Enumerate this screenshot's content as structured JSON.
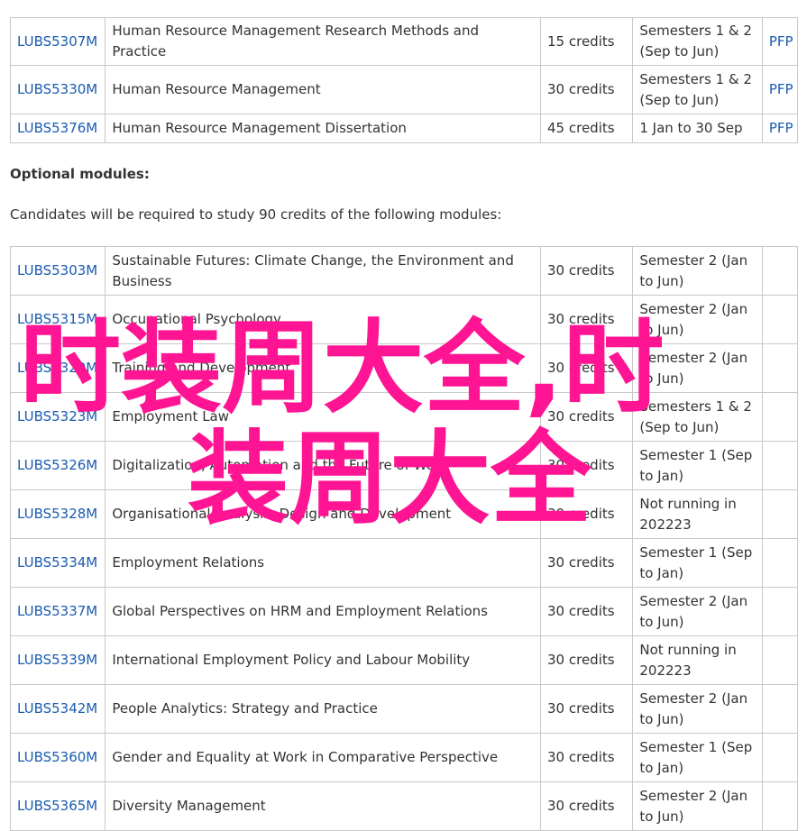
{
  "core_modules": [
    {
      "code": "LUBS5307M",
      "title": "Human Resource Management Research Methods and Practice",
      "credits": "15 credits",
      "semester": "Semesters 1 & 2 (Sep to Jun)",
      "pfp": "PFP"
    },
    {
      "code": "LUBS5330M",
      "title": "Human Resource Management",
      "credits": "30 credits",
      "semester": "Semesters 1 & 2 (Sep to Jun)",
      "pfp": "PFP"
    },
    {
      "code": "LUBS5376M",
      "title": "Human Resource Management Dissertation",
      "credits": "45 credits",
      "semester": "1 Jan to 30 Sep",
      "pfp": "PFP"
    }
  ],
  "optional_section": {
    "heading": "Optional modules:",
    "intro": "Candidates will be required to study 90 credits of the following modules:"
  },
  "optional_modules": [
    {
      "code": "LUBS5303M",
      "title": "Sustainable Futures: Climate Change, the Environment and Business",
      "credits": "30 credits",
      "semester": "Semester 2 (Jan to Jun)"
    },
    {
      "code": "LUBS5315M",
      "title": "Occupational Psychology",
      "credits": "30 credits",
      "semester": "Semester 2 (Jan to Jun)"
    },
    {
      "code": "LUBS5320M",
      "title": "Training and Development",
      "credits": "30 credits",
      "semester": "Semester 2 (Jan to Jun)"
    },
    {
      "code": "LUBS5323M",
      "title": "Employment Law",
      "credits": "30 credits",
      "semester": "Semesters 1 & 2 (Sep to Jun)"
    },
    {
      "code": "LUBS5326M",
      "title": "Digitalization, Automation and the Future of Work",
      "credits": "30 credits",
      "semester": "Semester 1 (Sep to Jan)"
    },
    {
      "code": "LUBS5328M",
      "title": "Organisational Analysis, Design and Development",
      "credits": "30 credits",
      "semester": "Not running in 202223"
    },
    {
      "code": "LUBS5334M",
      "title": "Employment Relations",
      "credits": "30 credits",
      "semester": "Semester 1 (Sep to Jan)"
    },
    {
      "code": "LUBS5337M",
      "title": "Global Perspectives on HRM and Employment Relations",
      "credits": "30 credits",
      "semester": "Semester 2 (Jan to Jun)"
    },
    {
      "code": "LUBS5339M",
      "title": "International Employment Policy and Labour Mobility",
      "credits": "30 credits",
      "semester": "Not running in 202223"
    },
    {
      "code": "LUBS5342M",
      "title": "People Analytics: Strategy and Practice",
      "credits": "30 credits",
      "semester": "Semester 2 (Jan to Jun)"
    },
    {
      "code": "LUBS5360M",
      "title": "Gender and Equality at Work in Comparative Perspective",
      "credits": "30 credits",
      "semester": "Semester 1 (Sep to Jan)"
    },
    {
      "code": "LUBS5365M",
      "title": "Diversity Management",
      "credits": "30 credits",
      "semester": "Semester 2 (Jan to Jun)"
    }
  ],
  "watermark": {
    "line1": "时装周大全,时",
    "line2": "装周大全",
    "color": "#ff1493"
  },
  "link_color": "#1a5bb0"
}
